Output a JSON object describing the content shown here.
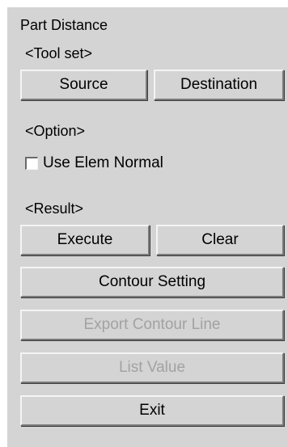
{
  "panel": {
    "title": "Part Distance",
    "tool_set_label": "<Tool set>",
    "option_label": "<Option>",
    "result_label": "<Result>"
  },
  "buttons": {
    "source": "Source",
    "destination": "Destination",
    "execute": "Execute",
    "clear": "Clear",
    "contour_setting": "Contour Setting",
    "export_contour_line": "Export Contour Line",
    "list_value": "List Value",
    "exit": "Exit"
  },
  "options": {
    "use_elem_normal": {
      "label": "Use Elem Normal",
      "checked": false
    }
  },
  "colors": {
    "panel_bg": "#d4d4d4",
    "disabled_text": "#a2a2a2"
  }
}
